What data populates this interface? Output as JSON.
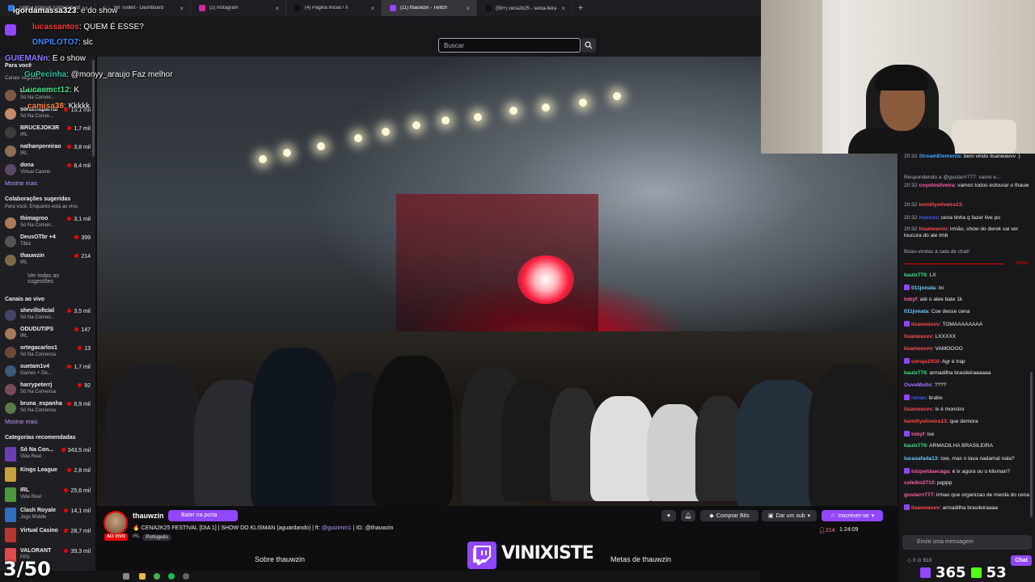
{
  "browser": {
    "tabs": [
      {
        "label": "Trello | Acessar Fornecimento",
        "active": false
      },
      {
        "label": "IRI Toolkit - Dashboard",
        "active": false
      },
      {
        "label": "(2) Instagram",
        "active": false
      },
      {
        "label": "(4) Página Inicial / X",
        "active": false
      },
      {
        "label": "(11) thauwzin - Twitch",
        "active": true
      },
      {
        "label": "(99+) cena2k25 - sexta-feira ⊕",
        "active": false
      }
    ],
    "new_tab": "+"
  },
  "topnav": {
    "search_placeholder": "Buscar"
  },
  "sidebar": {
    "for_you": "Para você",
    "followed_head": "Canais seguidos",
    "followed": [
      {
        "name": "Lucasmct12",
        "cat": "Só Na Conver...",
        "count": ""
      },
      {
        "name": "sorachaparral",
        "cat": "Só Na Conve...",
        "count": "15,1 mil"
      },
      {
        "name": "BRUCEJOK3R",
        "cat": "IRL",
        "count": "1,7 mil"
      },
      {
        "name": "nathanpereirao",
        "cat": "IRL",
        "count": "3,8 mil"
      },
      {
        "name": "dona",
        "cat": "Virtual Casino",
        "count": "8,4 mil"
      }
    ],
    "show_more_1": "Mostrar mais",
    "collab_head": "Colaborações sugeridas",
    "collab_sub": "Para você. Enquanto está ao vivo.",
    "collabs": [
      {
        "name": "thimagroo",
        "cat": "Só Na Conver...",
        "count": "3,1 mil"
      },
      {
        "name": "DeusOTbr +4",
        "cat": "Tibia",
        "count": "399"
      },
      {
        "name": "thauwzin",
        "cat": "IRL",
        "count": "214"
      }
    ],
    "see_all": "Ver todas as sugestões",
    "live_head": "Canais ao vivo",
    "live": [
      {
        "name": "shevilloficial",
        "cat": "Só Na Conver...",
        "count": "3,5 mil"
      },
      {
        "name": "ODUDUTIPS",
        "cat": "IRL",
        "count": "147"
      },
      {
        "name": "ortegacarlos1",
        "cat": "Só Na Conversa",
        "count": "13"
      },
      {
        "name": "suetam1v4",
        "cat": "Games + De...",
        "count": "1,7 mil"
      },
      {
        "name": "harrypeterrj",
        "cat": "Só Na Conversa",
        "count": "92"
      },
      {
        "name": "bruna_espanha",
        "cat": "Só Na Conversa",
        "count": "8,9 mil"
      }
    ],
    "show_more_2": "Mostrar mais",
    "cats_head": "Categorias recomendadas",
    "categories": [
      {
        "name": "Só Na Con...",
        "cat": "Vida Real",
        "count": "343,5 mil",
        "color": "#6b3fb3"
      },
      {
        "name": "Kings League",
        "cat": "",
        "count": "2,8 mil",
        "color": "#c7a13b"
      },
      {
        "name": "IRL",
        "cat": "Vida Real",
        "count": "25,6 mil",
        "color": "#4c9a3c"
      },
      {
        "name": "Clash Royale",
        "cat": "Jogo Mobile",
        "count": "14,1 mil",
        "color": "#2f6fc2"
      },
      {
        "name": "Virtual Casino",
        "cat": "",
        "count": "28,7 mil",
        "color": "#b8362f"
      },
      {
        "name": "VALORANT",
        "cat": "FPS",
        "count": "39,3 mil",
        "color": "#e24a4a"
      }
    ]
  },
  "overlay_chat": [
    {
      "user": "igordamassa323",
      "msg": ": é do show",
      "color": "#ffffff"
    },
    {
      "user": "lucassantos",
      "msg": ": QUEM É ESSE?",
      "color": "#ff3b3b"
    },
    {
      "user": "DNPILOTO7",
      "msg": ": slc",
      "color": "#3b8bff"
    },
    {
      "user": "GUIEMANn",
      "msg": ": E o show",
      "color": "#8f7bff"
    },
    {
      "user": "GuPecinha",
      "msg": ": @monyy_araujo Faz melhor",
      "color": "#2fc3a8"
    },
    {
      "user": "Lucasmct12",
      "msg": ": K",
      "color": "#3be07a"
    },
    {
      "user": "camisa38",
      "msg": ": Kkkkk",
      "color": "#ff8a3b"
    }
  ],
  "chat": {
    "messages": [
      {
        "time": "20:32",
        "user": "StreamElements",
        "msg": ": bem vindo lisanwavvv :)",
        "color": "#3ba6ff"
      },
      {
        "time": "",
        "user": "",
        "msg": "Respondendo a @gustarrr777: vamo e...",
        "color": "#adadb8"
      },
      {
        "time": "20:32",
        "user": "coyotesilveira",
        "msg": ": vamos todos estourar o thauw",
        "color": "#ff5fa8"
      },
      {
        "time": "20:32",
        "user": "kemillyoliveira13",
        "msg": ":",
        "color": "#ff4b4b"
      },
      {
        "time": "20:32",
        "user": "marcos",
        "msg": ": cena tinha q fazer live po",
        "color": "#3b5cff"
      },
      {
        "time": "20:32",
        "user": "lisanwavvv",
        "msg": ": irmão, show do derek vai ser loucura do ale tmb",
        "color": "#ff4b4b"
      }
    ],
    "welcome": "Boas-vindas à sala de chat!",
    "new_label": "Novo",
    "messages2": [
      {
        "user": "kautz776",
        "msg": ": LX",
        "color": "#3be07a"
      },
      {
        "user": "011jonata",
        "msg": ": lxi",
        "color": "#6ecbff"
      },
      {
        "user": "tobyf",
        "msg": ": até o alee bate 1k",
        "color": "#ff5fa8"
      },
      {
        "user": "011jonata",
        "msg": ": Coe desse cena",
        "color": "#6ecbff"
      },
      {
        "user": "lisanwavvv",
        "msg": ": TOMAAAAAAAA",
        "color": "#ff4b4b"
      },
      {
        "user": "lisanwavvv",
        "msg": ": LXXXXX",
        "color": "#ff4b4b"
      },
      {
        "user": "lisanwavvv",
        "msg": ": VAMOOOO",
        "color": "#ff4b4b"
      },
      {
        "user": "coruja1910",
        "msg": ": Agr é trap",
        "color": "#ff4b4b"
      },
      {
        "user": "kautz776",
        "msg": ": armadilha brasileiraaaaaa",
        "color": "#3be07a"
      },
      {
        "user": "OuveMuito",
        "msg": ": ????",
        "color": "#a970ff"
      },
      {
        "user": "renan",
        "msg": ": brabo",
        "color": "#3b5cff"
      },
      {
        "user": "lisanwavvv",
        "msg": ": lx é monstro",
        "color": "#ff4b4b"
      },
      {
        "user": "kemillyoliveira13",
        "msg": ": que demora",
        "color": "#ff4b4b"
      },
      {
        "user": "tobyf",
        "msg": ": lxe",
        "color": "#ff5fa8"
      },
      {
        "user": "kautz776",
        "msg": ": ARMADILHA BRASILEIRA",
        "color": "#3be07a"
      },
      {
        "user": "lucasafada13",
        "msg": ": oxe, mas n tava nadamal nala?",
        "color": "#6ecbff"
      },
      {
        "user": "luizpeldaecaga",
        "msg": ": é lx agora ou o klisman?",
        "color": "#ff5fa8"
      },
      {
        "user": "coleiko2710",
        "msg": ": pqppp",
        "color": "#ff5fa8"
      },
      {
        "user": "gustarrr777",
        "msg": ": irmao que organizao de merda do cena",
        "color": "#ff5fa8"
      },
      {
        "user": "lisanwavvv",
        "msg": ": armadilha brasileiraaaa",
        "color": "#ff4b4b"
      }
    ],
    "input_placeholder": "Envie uma mensagem",
    "points": "0",
    "points2": "810",
    "send_label": "Chat"
  },
  "stream": {
    "channel": "thauwzin",
    "knock_label": "Bater na porta",
    "title": "🔥 CENA2K25 FESTIVAL [DIA 1] | SHOW DO KLISMAN (aguardando) | ft: ",
    "title_mention": "@guizimm1",
    "title_tail": " | IG: @thauwzin",
    "live_label": "AO VIVO",
    "tag_irl": "IRL",
    "tag_lang": "Português",
    "bits_label": "Comprar Bits",
    "gift_label": "Dar um sub",
    "subscribe_label": "Inscrever-se",
    "viewers": "214",
    "uptime": "1:24:09",
    "about_label": "Sobre thauwzin",
    "goals_label": "Metas de thauwzin"
  },
  "overlay": {
    "brand": "VINIXISTE",
    "counter": "3/50",
    "stat1": "365",
    "stat2": "53"
  }
}
